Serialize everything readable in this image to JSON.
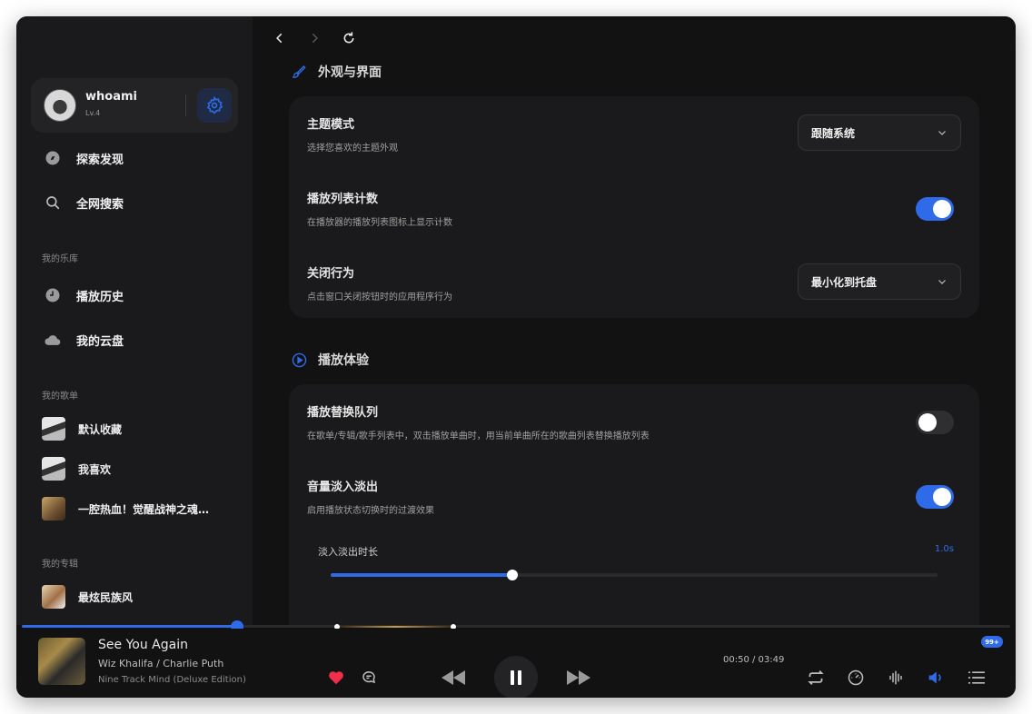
{
  "sidebar": {
    "user": {
      "name": "whoami",
      "level": "Lv.4"
    },
    "nav_main": [
      {
        "label": "探索发现",
        "icon": "compass-icon"
      },
      {
        "label": "全网搜索",
        "icon": "search-icon"
      }
    ],
    "library_title": "我的乐库",
    "library": [
      {
        "label": "播放历史",
        "icon": "clock-icon"
      },
      {
        "label": "我的云盘",
        "icon": "cloud-icon"
      }
    ],
    "playlists_title": "我的歌单",
    "playlists": [
      {
        "label": "默认收藏"
      },
      {
        "label": "我喜欢"
      },
      {
        "label": "一腔热血！觉醒战神之魂…"
      }
    ],
    "albums_title": "我的专辑",
    "albums": [
      {
        "label": "最炫民族风"
      }
    ]
  },
  "main": {
    "section_appearance": {
      "title": "外观与界面",
      "icon": "brush-icon"
    },
    "appearance_rows": [
      {
        "title": "主题模式",
        "desc": "选择您喜欢的主题外观",
        "control": "select",
        "value": "跟随系统"
      },
      {
        "title": "播放列表计数",
        "desc": "在播放器的播放列表图标上显示计数",
        "control": "toggle",
        "on": true
      },
      {
        "title": "关闭行为",
        "desc": "点击窗口关闭按钮时的应用程序行为",
        "control": "select",
        "value": "最小化到托盘"
      }
    ],
    "section_playback": {
      "title": "播放体验",
      "icon": "play-circle-icon"
    },
    "playback_rows": [
      {
        "title": "播放替换队列",
        "desc": "在歌单/专辑/歌手列表中，双击播放单曲时，用当前单曲所在的歌曲列表替换播放列表",
        "control": "toggle",
        "on": false
      },
      {
        "title": "音量淡入淡出",
        "desc": "启用播放状态切换时的过渡效果",
        "control": "toggle",
        "on": true
      }
    ],
    "fade_slider": {
      "label": "淡入淡出时长",
      "value_text": "1.0s",
      "fraction": 0.3
    }
  },
  "player": {
    "title": "See You Again",
    "artist": "Wiz Khalifa / Charlie Puth",
    "album": "Nine Track Mind (Deluxe Edition)",
    "current_time": "00:50",
    "total_time": "03:49",
    "time_text": "00:50 / 03:49",
    "progress_fraction": 0.218,
    "queue_badge": "99+",
    "liked": true
  },
  "colors": {
    "accent": "#2f6be8",
    "like_red": "#f0304a"
  }
}
